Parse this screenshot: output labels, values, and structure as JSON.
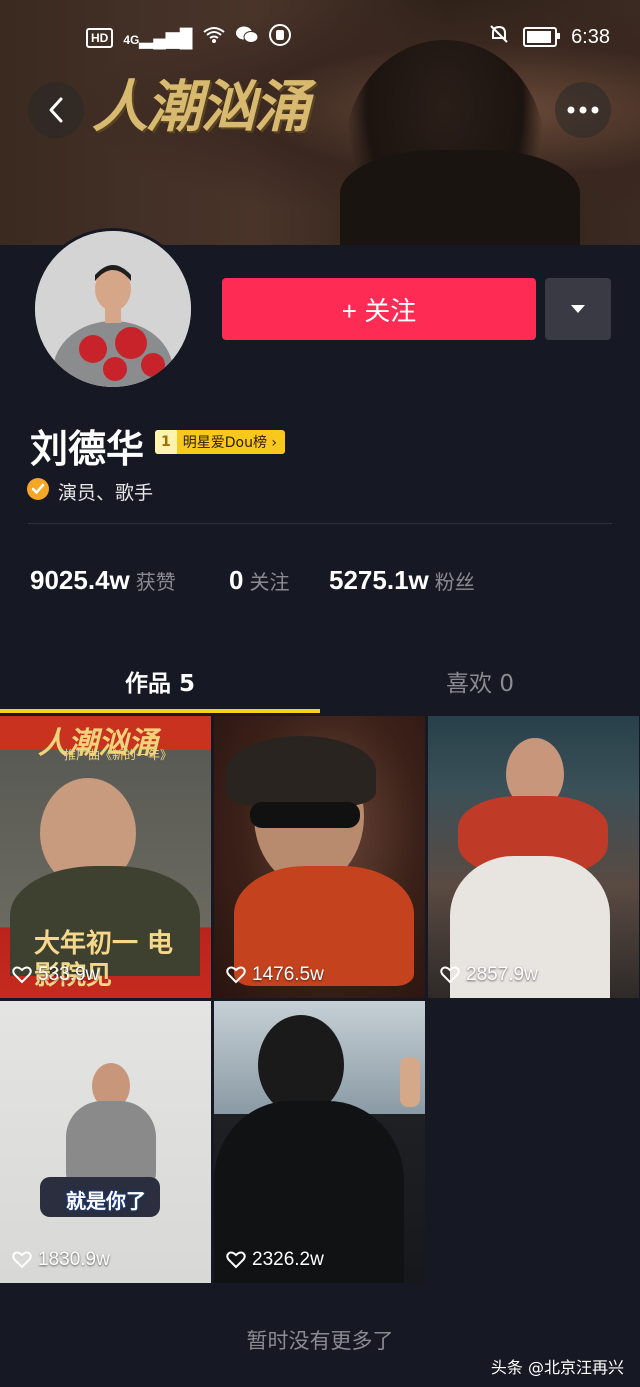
{
  "status_bar": {
    "hd": "HD",
    "network": "4G",
    "time": "6:38"
  },
  "banner": {
    "title": "人潮汹涌"
  },
  "profile": {
    "name": "刘德华",
    "rank_number": "1",
    "rank_label": "明星爱Dou榜 ›",
    "profession": "演员、歌手",
    "follow_label": "+ 关注"
  },
  "stats": [
    {
      "value": "9025.4w",
      "label": "获赞"
    },
    {
      "value": "0",
      "label": "关注"
    },
    {
      "value": "5275.1w",
      "label": "粉丝"
    }
  ],
  "tabs": {
    "works": "作品 5",
    "likes": "喜欢 0"
  },
  "videos": [
    {
      "likes": "533.9w",
      "overlay_top": "人潮汹涌",
      "overlay_sub": "推广曲《新的一年》",
      "overlay_bottom": "大年初一 电影院见"
    },
    {
      "likes": "1476.5w"
    },
    {
      "likes": "2857.9w"
    },
    {
      "likes": "1830.9w",
      "caption": "就是你了"
    },
    {
      "likes": "2326.2w"
    }
  ],
  "footer": {
    "no_more": "暂时没有更多了",
    "watermark": "头条 @北京汪再兴"
  },
  "colors": {
    "background": "#161823",
    "follow": "#fe2c55",
    "tab_indicator": "#facf1e",
    "rank_badge": "#f8c81c"
  },
  "icons": [
    "back-icon",
    "more-icon",
    "dropdown-icon",
    "verified-icon",
    "heart-icon"
  ]
}
